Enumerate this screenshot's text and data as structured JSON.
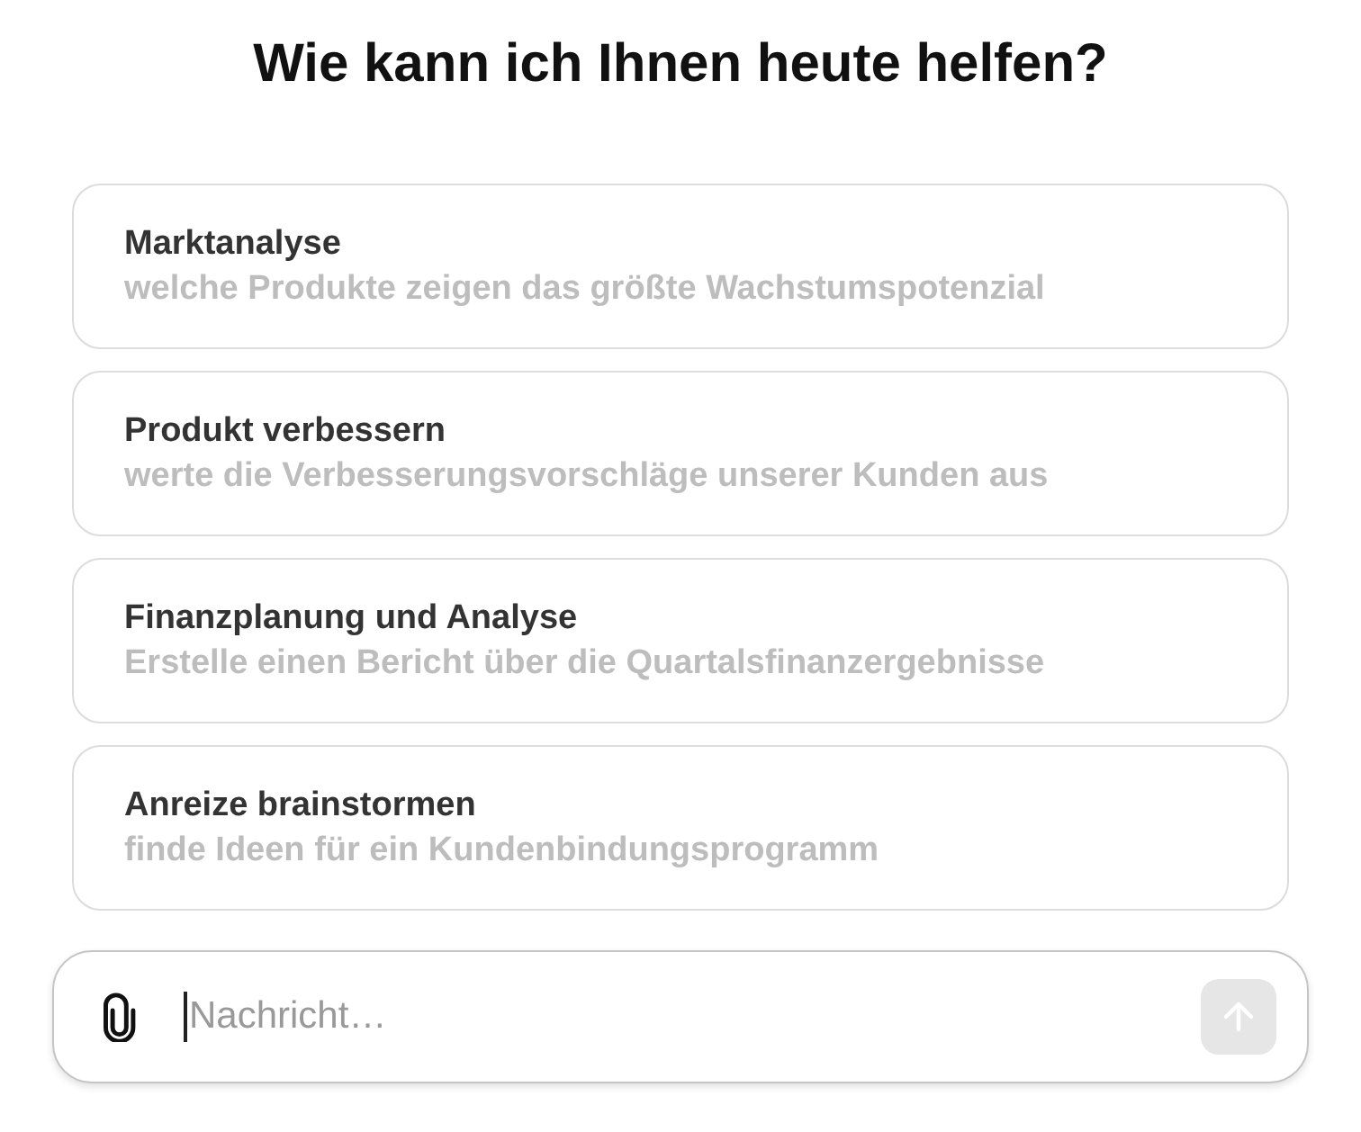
{
  "heading": "Wie kann ich Ihnen heute helfen?",
  "suggestions": [
    {
      "title": "Marktanalyse",
      "prompt": "welche Produkte zeigen das größte Wachstumspotenzial"
    },
    {
      "title": "Produkt verbessern",
      "prompt": "werte die Verbesserungsvorschläge unserer Kunden aus"
    },
    {
      "title": "Finanzplanung und Analyse",
      "prompt": "Erstelle einen Bericht über die Quartalsfinanzergebnisse"
    },
    {
      "title": "Anreize brainstormen",
      "prompt": "finde Ideen für ein Kundenbindungsprogramm"
    }
  ],
  "composer": {
    "placeholder": "Nachricht…",
    "send_disabled": true
  }
}
